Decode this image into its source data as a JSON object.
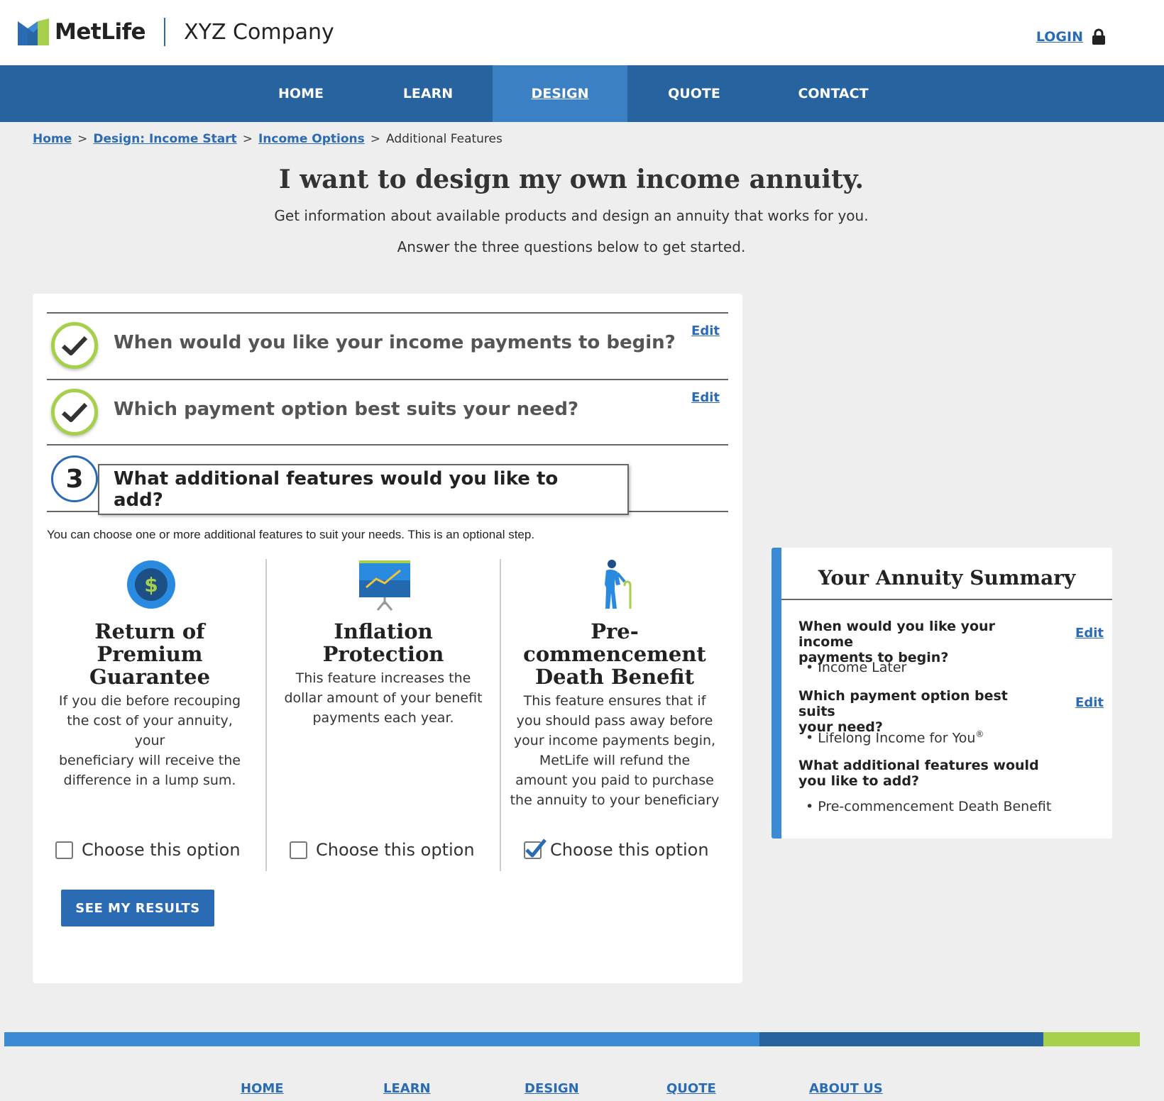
{
  "brand": {
    "logo_text": "MetLife",
    "company": "XYZ Company",
    "colors": {
      "primary": "#27639f",
      "accent": "#3a8ad6",
      "green": "#a6cf4b"
    }
  },
  "header": {
    "login_label": "LOGIN",
    "login_icon": "lock-icon"
  },
  "nav": {
    "items": [
      {
        "label": "HOME"
      },
      {
        "label": "LEARN"
      },
      {
        "label": "DESIGN",
        "active": true
      },
      {
        "label": "QUOTE"
      },
      {
        "label": "CONTACT"
      }
    ]
  },
  "breadcrumb": {
    "items": [
      "Home",
      "Design: Income Start",
      "Income Options"
    ],
    "current": "Additional Features",
    "separator": ">"
  },
  "hero": {
    "title": "I want to design my own income annuity.",
    "subtitle": "Get information about available products and design an annuity that works for you.",
    "instruction": "Answer the three questions below to get started."
  },
  "questions": [
    {
      "text": "When would you like your income payments to begin?",
      "status": "complete",
      "edit_label": "Edit"
    },
    {
      "text": "Which payment option best suits your need?",
      "status": "complete",
      "edit_label": "Edit"
    },
    {
      "number": "3",
      "text": "What additional features would you like to add?",
      "status": "current"
    }
  ],
  "features": {
    "intro": "You can choose one or more additional features to suit your needs. This is an optional step.",
    "choice_label": "Choose this option",
    "items": [
      {
        "icon": "dollar-coin-icon",
        "title_lines": [
          "Return of",
          "Premium",
          "Guarantee"
        ],
        "desc_lines": [
          "If you die before recouping",
          "the cost of your annuity, your",
          "beneficiary will receive the",
          "difference in a lump sum."
        ],
        "checked": false
      },
      {
        "icon": "growth-chart-icon",
        "title_lines": [
          "Inflation",
          "Protection"
        ],
        "desc_lines": [
          "This feature increases the",
          "dollar amount of your benefit",
          "payments each year."
        ],
        "checked": false
      },
      {
        "icon": "elderly-person-icon",
        "title_lines": [
          "Pre-",
          "commencement",
          "Death Benefit"
        ],
        "desc_lines": [
          "This feature ensures that if",
          "you should pass away before",
          "your income payments begin,",
          "MetLife will refund the",
          "amount you paid to purchase",
          "the annuity to your beneficiary"
        ],
        "checked": true
      }
    ],
    "results_button": "SEE MY RESULTS"
  },
  "summary": {
    "title": "Your Annuity Summary",
    "edit_label": "Edit",
    "items": [
      {
        "question_lines": [
          "When would you like your income",
          "payments to begin?"
        ],
        "answer": "Income Later"
      },
      {
        "question_lines": [
          "Which payment option best suits",
          "your need?"
        ],
        "answer": "Lifelong Income for You",
        "answer_sup": "®"
      },
      {
        "question_lines": [
          "What additional features would",
          "you like to add?"
        ],
        "answer": "Pre-commencement Death Benefit"
      }
    ]
  },
  "footer": {
    "nav": [
      "HOME",
      "LEARN",
      "DESIGN",
      "QUOTE",
      "ABOUT US"
    ],
    "bar_colors": [
      "#3a8ad6",
      "#27639f",
      "#a6cf4b"
    ]
  }
}
